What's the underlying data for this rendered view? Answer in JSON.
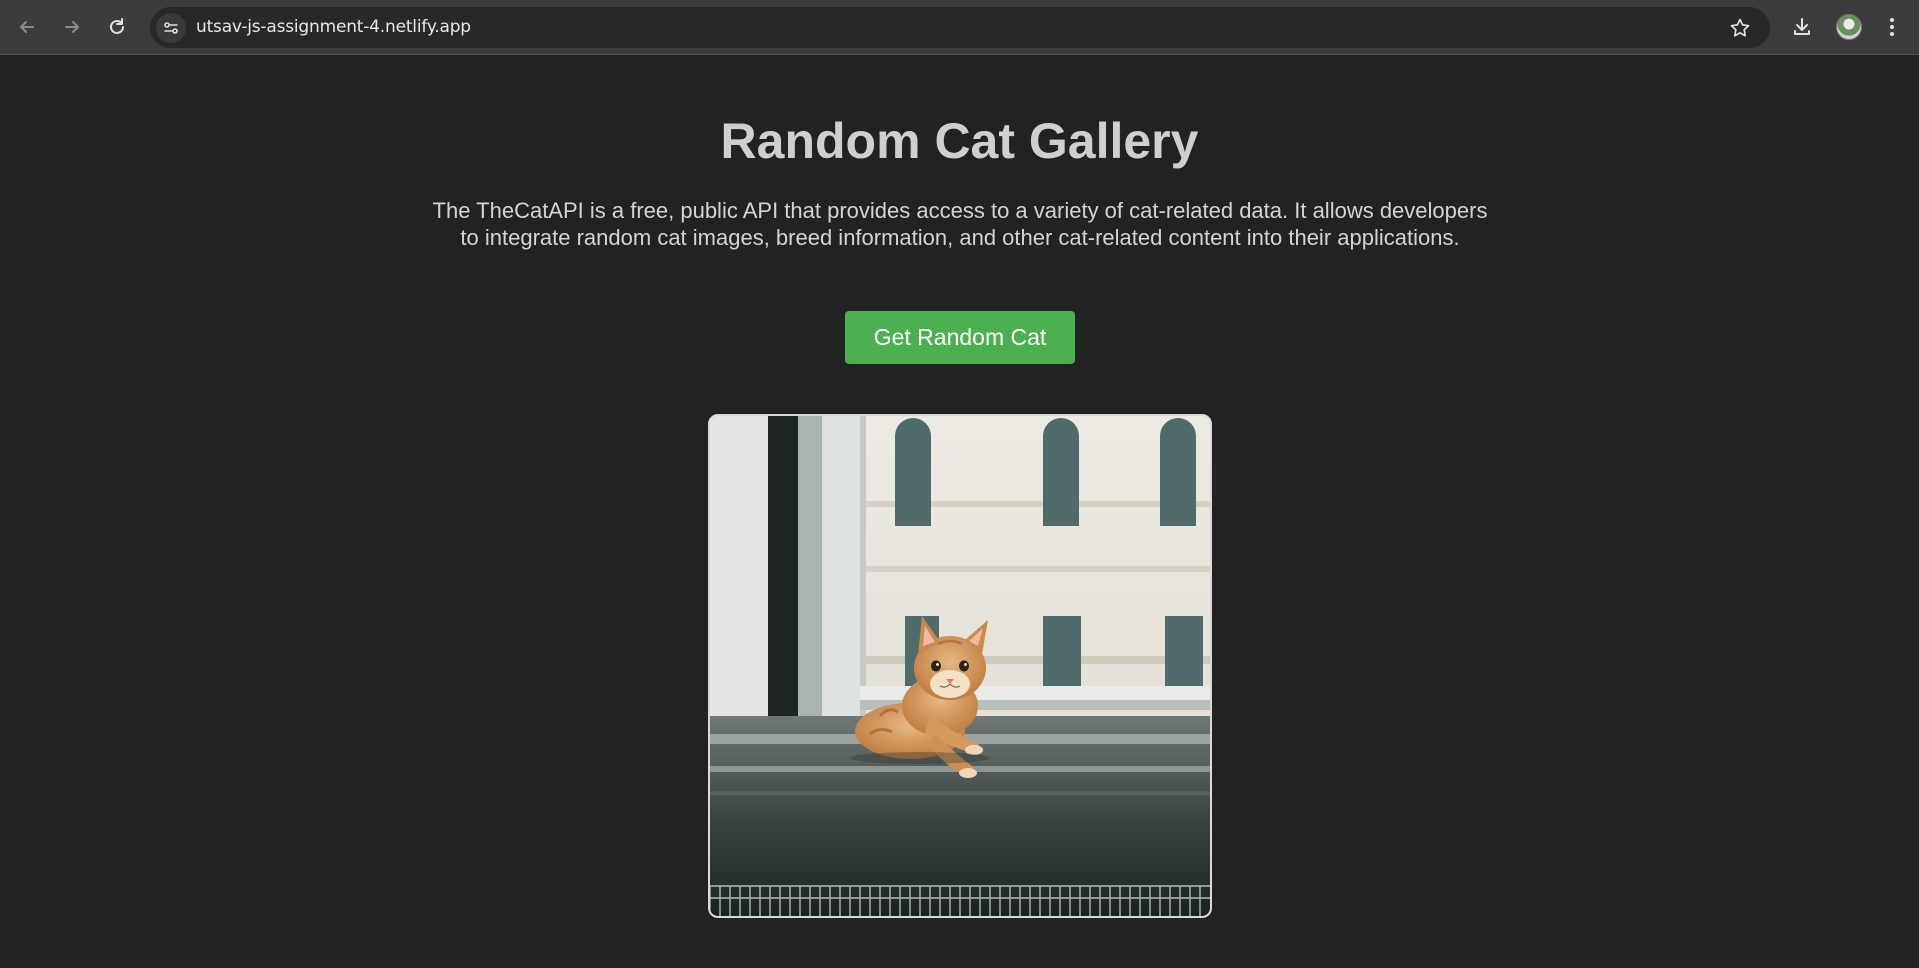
{
  "browser": {
    "url": "utsav-js-assignment-4.netlify.app",
    "icons": [
      "back-arrow-icon",
      "forward-arrow-icon",
      "reload-icon",
      "site-info-icon",
      "star-icon",
      "download-icon",
      "profile-avatar",
      "more-menu-icon"
    ]
  },
  "page": {
    "title": "Random Cat Gallery",
    "description": "The TheCatAPI is a free, public API that provides access to a variety of cat-related data. It allows developers to integrate random cat images, breed information, and other cat-related content into their applications.",
    "button_label": "Get Random Cat",
    "image_alt": "Random cat photo",
    "accent_color": "#4caf50",
    "background_color": "#222222"
  }
}
